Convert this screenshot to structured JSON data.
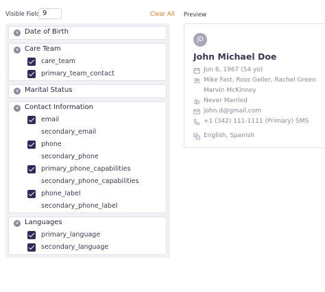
{
  "header": {
    "visible_fields_label": "Visible Fields",
    "visible_fields_value": "9",
    "clear_all": "Clear All"
  },
  "groups": [
    {
      "title": "Date of Birth",
      "items": []
    },
    {
      "title": "Care Team",
      "items": [
        {
          "label": "care_team",
          "checked": true
        },
        {
          "label": "primary_team_contact",
          "checked": true
        }
      ]
    },
    {
      "title": "Marital Status",
      "items": []
    },
    {
      "title": "Contact Information",
      "items": [
        {
          "label": "email",
          "checked": true
        },
        {
          "label": "secondary_email",
          "checked": false
        },
        {
          "label": "phone",
          "checked": true
        },
        {
          "label": "secondary_phone",
          "checked": false
        },
        {
          "label": "primary_phone_capabilities",
          "checked": true
        },
        {
          "label": "secondary_phone_capabilities",
          "checked": false
        },
        {
          "label": "phone_label",
          "checked": true
        },
        {
          "label": "secondary_phone_label",
          "checked": false
        }
      ]
    },
    {
      "title": "Languages",
      "items": [
        {
          "label": "primary_language",
          "checked": true
        },
        {
          "label": "secondary_language",
          "checked": true
        }
      ]
    }
  ],
  "preview": {
    "label": "Preview",
    "initials": "JD",
    "name": "John Michael Doe",
    "dob": "Jun 6, 1967 (54 yo)",
    "care_team_line1": "Mike Fast, Ross Geller, Rachel Green",
    "care_team_line2": "Marvin McKinney",
    "marital": "Never Married",
    "email": "john.d@gmail.com",
    "phone": "+1 (342) 111-1111 (Primary) SMS",
    "languages": "English, Spanish"
  },
  "colors": {
    "accent": "#e07a1f",
    "checkbox": "#2e2a5c",
    "muted": "#8a889c"
  }
}
